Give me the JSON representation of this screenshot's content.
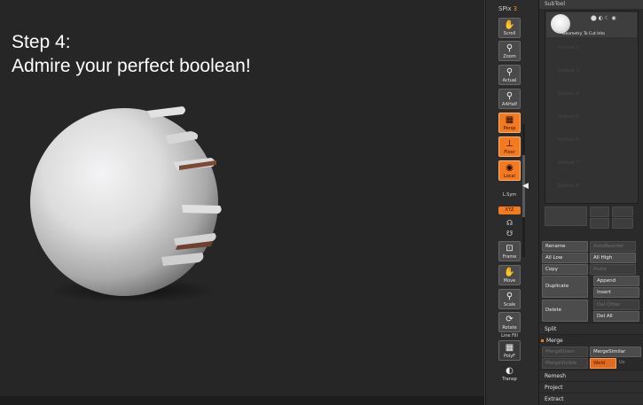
{
  "viewport": {
    "step_title": "Step 4:",
    "step_subtitle": "Admire your perfect boolean!"
  },
  "shelf": {
    "spix_label": "SPix",
    "spix_value": "3",
    "buttons": [
      {
        "id": "scroll",
        "label": "Scroll",
        "icon": "hand-icon"
      },
      {
        "id": "zoom",
        "label": "Zoom",
        "icon": "magnifier-icon"
      },
      {
        "id": "actual",
        "label": "Actual",
        "icon": "magnifier-icon"
      },
      {
        "id": "aahalf",
        "label": "AAHalf",
        "icon": "magnifier-icon"
      },
      {
        "id": "persp",
        "label": "Persp",
        "icon": "grid-icon"
      },
      {
        "id": "floor",
        "label": "Floor",
        "icon": "floor-icon"
      },
      {
        "id": "local",
        "label": "Local",
        "icon": "local-icon"
      },
      {
        "id": "lsym",
        "label": "L.Sym",
        "icon": "xyz-icon"
      },
      {
        "id": "xyz",
        "label": "XYZ",
        "icon": "xyz-icon"
      },
      {
        "id": "frame",
        "label": "Frame",
        "icon": "frame-icon"
      },
      {
        "id": "move",
        "label": "Move",
        "icon": "move-icon"
      },
      {
        "id": "scale",
        "label": "Scale",
        "icon": "scale-icon"
      },
      {
        "id": "rotate",
        "label": "Rotate",
        "icon": "rotate-icon"
      },
      {
        "id": "polyf",
        "label": "PolyF",
        "icon": "polyframe-icon"
      },
      {
        "id": "transp",
        "label": "Transp",
        "icon": "transp-icon"
      }
    ],
    "line_fill_label": "Line Fill"
  },
  "subtool": {
    "header": "SubTool",
    "active_name": "Geometry To Cut Into",
    "empty_slots": [
      "Subtool 2",
      "Subtool 3",
      "Subtool 4",
      "Subtool 5",
      "Subtool 6",
      "Subtool 7",
      "Subtool 8"
    ],
    "buttons": {
      "rename": "Rename",
      "autoreorder": "AutoReorder",
      "all_low": "All Low",
      "all_high": "All High",
      "copy": "Copy",
      "paste": "Paste",
      "duplicate": "Duplicate",
      "append": "Append",
      "insert": "Insert",
      "delete": "Delete",
      "del_other": "Del Other",
      "del_all": "Del All",
      "merge_down": "MergeDown",
      "merge_similar": "MergeSimilar",
      "merge_visible": "MergeVisible",
      "weld": "Weld",
      "uv": "Uv"
    },
    "sections": {
      "split": "Split",
      "merge": "Merge",
      "remesh": "Remesh",
      "project": "Project",
      "extract": "Extract"
    }
  },
  "colors": {
    "accent_orange": "#f47a1f",
    "viewport_bg": "#262626"
  }
}
